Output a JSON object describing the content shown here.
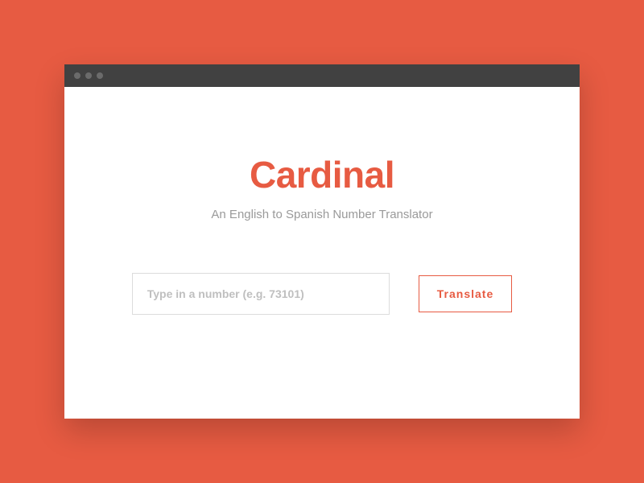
{
  "app": {
    "title": "Cardinal",
    "subtitle": "An English to Spanish Number Translator"
  },
  "form": {
    "input_placeholder": "Type in a number (e.g. 73101)",
    "input_value": "",
    "button_label": "Translate"
  },
  "colors": {
    "accent": "#e75b42",
    "titlebar": "#414141"
  }
}
